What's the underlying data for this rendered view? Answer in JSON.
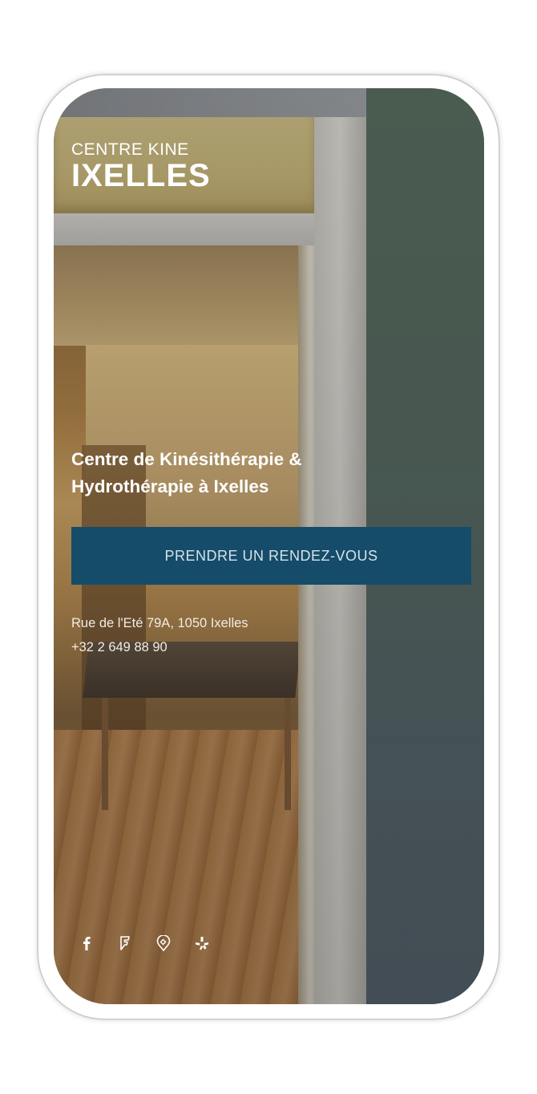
{
  "brand": {
    "line1": "CENTRE KINE",
    "line2": "IXELLES"
  },
  "hero": {
    "headline_line1": "Centre de Kinésithérapie &",
    "headline_line2": "Hydrothérapie à Ixelles",
    "cta_label": "PRENDRE UN RENDEZ-VOUS"
  },
  "contact": {
    "address": "Rue de l'Eté 79A, 1050 Ixelles",
    "phone": "+32 2 649 88 90"
  },
  "social": {
    "icons": [
      "facebook-icon",
      "foursquare-icon",
      "tripadvisor-icon",
      "yelp-icon"
    ]
  },
  "colors": {
    "cta_background": "#154c6a",
    "text": "#ffffff"
  }
}
